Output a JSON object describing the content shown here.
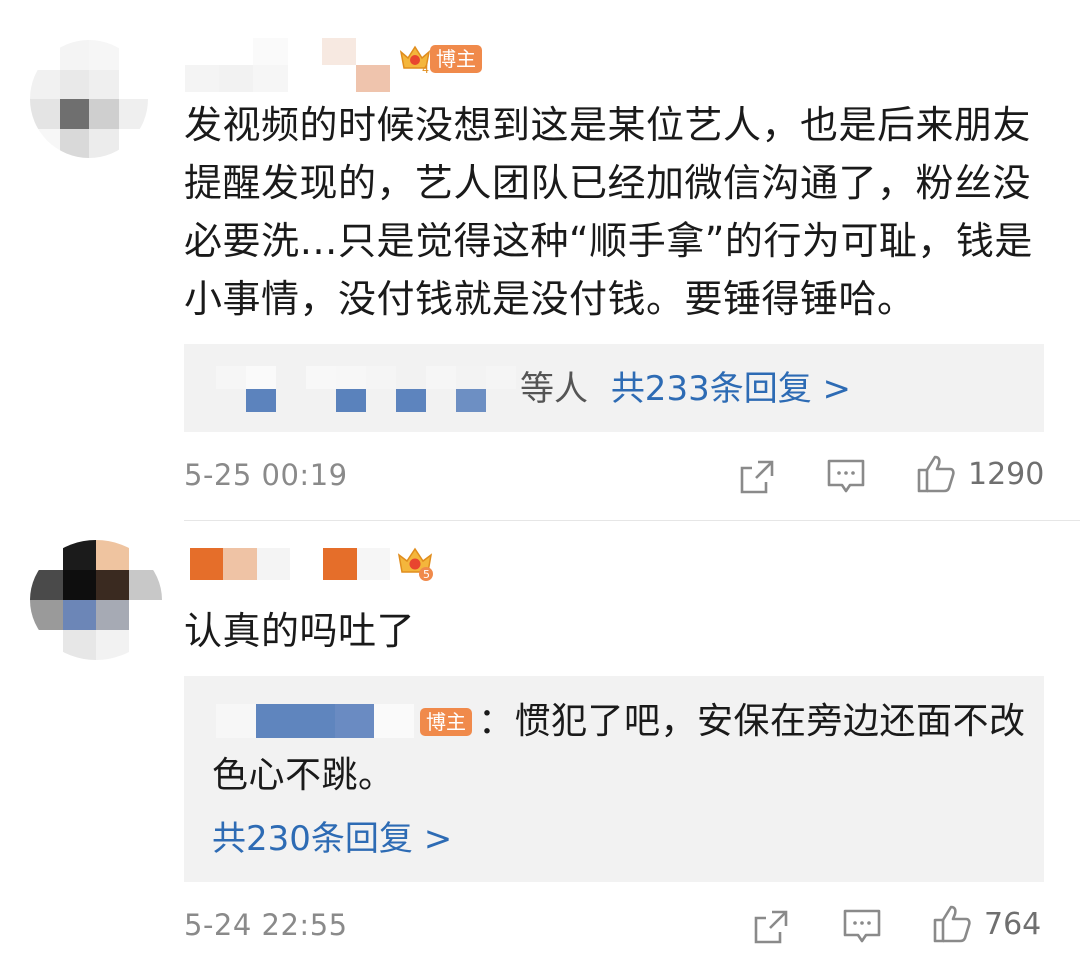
{
  "comments": [
    {
      "badge": "博主",
      "crown_level": "4",
      "text_lines": [
        "发视频的时候没想到这是某位艺人，也是后来朋友",
        "提醒发现的，艺人团队已经加微信沟通了，粉丝没",
        "必要洗…只是觉得这种“顺手拿”的行为可耻，钱是",
        "小事情，没付钱就是没付钱。要锤得锤哈。"
      ],
      "replies_prefix": "等人",
      "replies_link": "共233条回复 >",
      "time": "5-25 00:19",
      "like_count": "1290"
    },
    {
      "crown_level": "5",
      "text": "认真的吗吐了",
      "reply_badge": "博主",
      "reply_text_line1": "：惯犯了吧，安保在旁边还面不改",
      "reply_text_line2": "色心不跳。",
      "replies_link": "共230条回复 >",
      "time": "5-24 22:55",
      "like_count": "764"
    }
  ],
  "icons": [
    "share-icon",
    "comment-icon",
    "like-icon",
    "crown-icon"
  ],
  "colors": {
    "link": "#2d6bb4",
    "badge": "#f08a4b",
    "meta": "#8a8a8a",
    "reply_bg": "#f2f2f2"
  }
}
